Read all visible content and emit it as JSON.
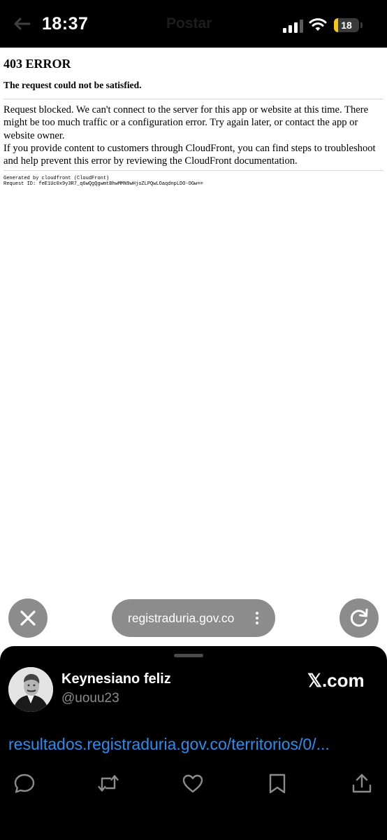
{
  "status_bar": {
    "time": "18:37",
    "ghost_title": "Postar",
    "battery": "18",
    "battery_level": 0.18,
    "icons": [
      "back-arrow-icon",
      "cellular-signal-icon",
      "wifi-icon",
      "battery-icon"
    ]
  },
  "page": {
    "title": "403 ERROR",
    "subtitle": "The request could not be satisfied.",
    "body_line1": "Request blocked. We can't connect to the server for this app or website at this time. There might be too much traffic or a configuration error. Try again later, or contact the app or website owner.",
    "body_line2": "If you provide content to customers through CloudFront, you can find steps to troubleshoot and help prevent this error by reviewing the CloudFront documentation.",
    "footer_generated": "Generated by cloudfront (CloudFront)",
    "footer_request_id": "Request ID: feE1Uc0x9y3R7_q6wQgQgwmtBhwMMN9wHjoZLPQwLOaqdnpLDO-OGw=="
  },
  "browser": {
    "url": "registraduria.gov.co",
    "icons": [
      "close-icon",
      "more-vertical-icon",
      "reload-icon"
    ]
  },
  "tweet": {
    "author_name": "Keynesiano feliz",
    "author_handle": "@uouu23",
    "brand": "𝕏.com",
    "link": "resultados.registraduria.gov.co/territorios/0/...",
    "accent": "#2a8df0",
    "icons": [
      "reply-icon",
      "retweet-icon",
      "like-icon",
      "bookmark-icon",
      "share-icon"
    ]
  }
}
